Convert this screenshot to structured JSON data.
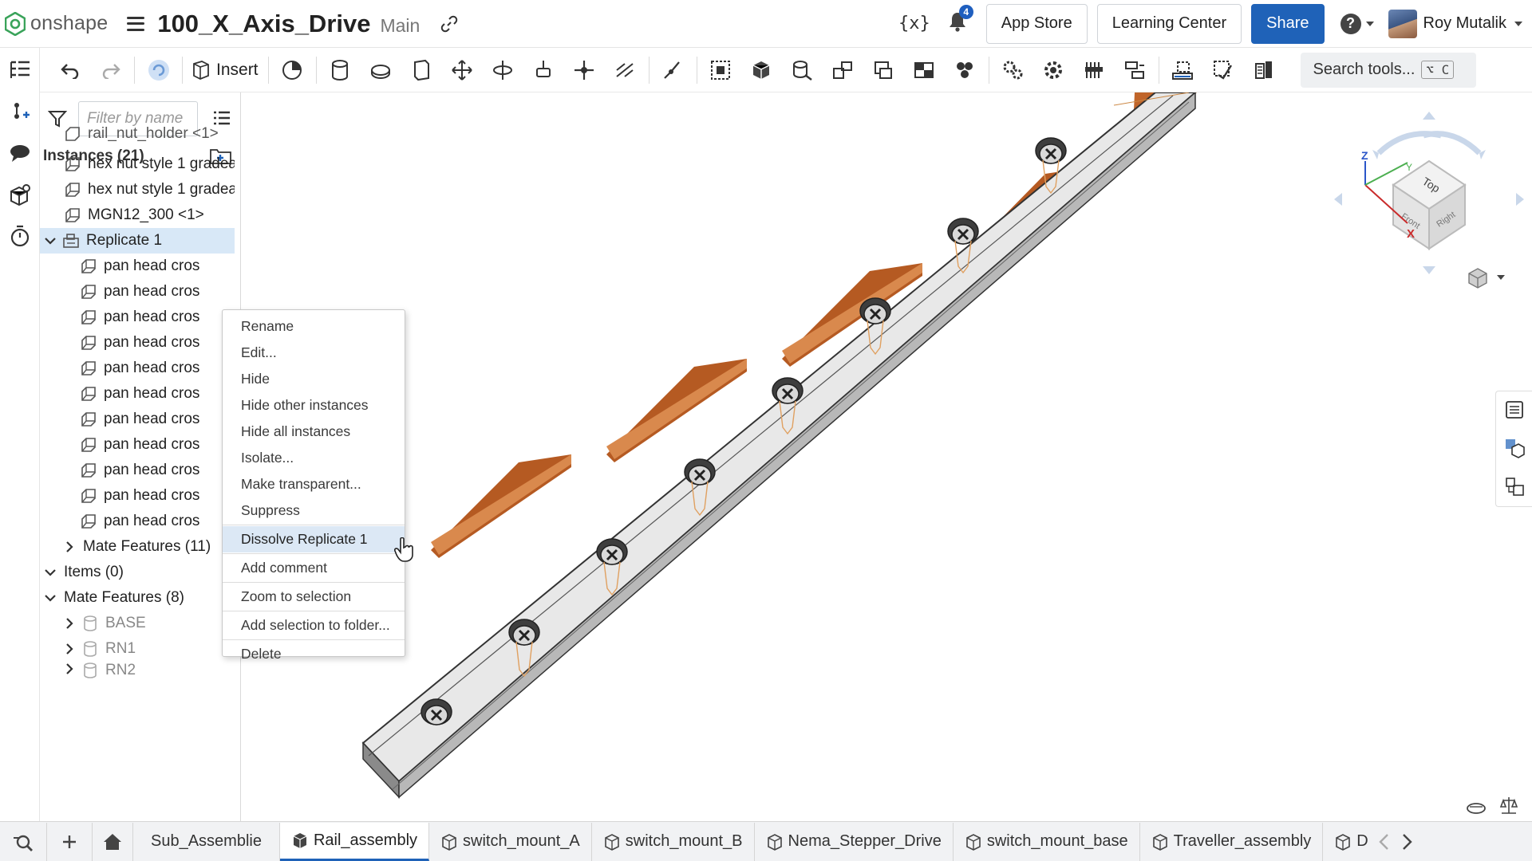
{
  "header": {
    "logo_text": "onshape",
    "doc_title": "100_X_Axis_Drive",
    "branch": "Main",
    "variables_label": "{x}",
    "notifications_count": "4",
    "app_store": "App Store",
    "learning_center": "Learning Center",
    "share": "Share",
    "help": "?",
    "user_name": "Roy Mutalik"
  },
  "toolbar": {
    "insert": "Insert",
    "search_tools": "Search tools...",
    "search_shortcut": "⌥ C"
  },
  "panel": {
    "filter_placeholder": "Filter by name",
    "instances_title": "Instances (21)",
    "rows": [
      {
        "label": "rail_nut_holder <1>"
      },
      {
        "label": "hex nut style 1 gradea..."
      },
      {
        "label": "hex nut style 1 gradea..."
      },
      {
        "label": "MGN12_300 <1>"
      },
      {
        "label": "Replicate 1"
      },
      {
        "label": "pan head cros"
      },
      {
        "label": "pan head cros"
      },
      {
        "label": "pan head cros"
      },
      {
        "label": "pan head cros"
      },
      {
        "label": "pan head cros"
      },
      {
        "label": "pan head cros"
      },
      {
        "label": "pan head cros"
      },
      {
        "label": "pan head cros"
      },
      {
        "label": "pan head cros"
      },
      {
        "label": "pan head cros"
      },
      {
        "label": "pan head cros"
      },
      {
        "label": "Mate Features (11)"
      },
      {
        "label": "Items (0)"
      },
      {
        "label": "Mate Features (8)"
      },
      {
        "label": "BASE"
      },
      {
        "label": "RN1"
      },
      {
        "label": "RN2"
      }
    ]
  },
  "context_menu": {
    "items": [
      "Rename",
      "Edit...",
      "Hide",
      "Hide other instances",
      "Hide all instances",
      "Isolate...",
      "Make transparent...",
      "Suppress",
      "Dissolve Replicate 1",
      "Add comment",
      "Zoom to selection",
      "Add selection to folder...",
      "Delete"
    ]
  },
  "view_cube": {
    "top": "Top",
    "front": "Front",
    "right": "Right",
    "x": "X",
    "y": "Y",
    "z": "Z"
  },
  "tabs": [
    "Sub_Assemblie",
    "Rail_assembly",
    "switch_mount_A",
    "switch_mount_B",
    "Nema_Stepper_Drive",
    "switch_mount_base",
    "Traveller_assembly",
    "D"
  ],
  "colors": {
    "accent": "#1f62b8",
    "selection": "#d8e8f7",
    "rail": "#e6e6e6",
    "nut_holder": "#c0652a"
  }
}
